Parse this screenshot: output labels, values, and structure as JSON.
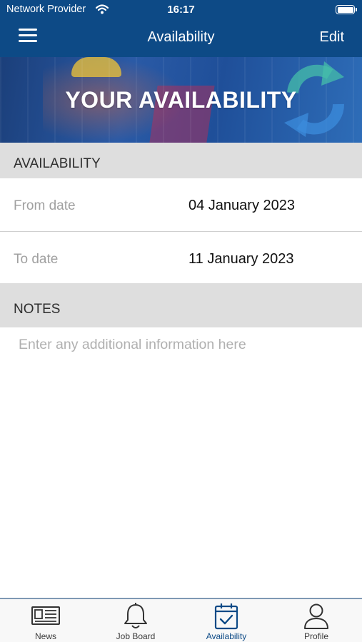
{
  "status_bar": {
    "carrier": "Network Provider",
    "time": "16:17"
  },
  "nav": {
    "title": "Availability",
    "edit_label": "Edit"
  },
  "banner": {
    "heading": "YOUR AVAILABILITY"
  },
  "availability": {
    "header": "AVAILABILITY",
    "from_label": "From date",
    "from_value": "04 January 2023",
    "to_label": "To date",
    "to_value": "11 January 2023"
  },
  "notes": {
    "header": "NOTES",
    "placeholder": "Enter any additional information here"
  },
  "tabs": [
    {
      "label": "News",
      "icon": "newspaper-icon",
      "active": false
    },
    {
      "label": "Job Board",
      "icon": "bell-icon",
      "active": false
    },
    {
      "label": "Availability",
      "icon": "calendar-check-icon",
      "active": true
    },
    {
      "label": "Profile",
      "icon": "person-icon",
      "active": false
    }
  ],
  "colors": {
    "brand": "#0d4a86",
    "section_bg": "#dedede",
    "placeholder": "#b0b0b0"
  }
}
